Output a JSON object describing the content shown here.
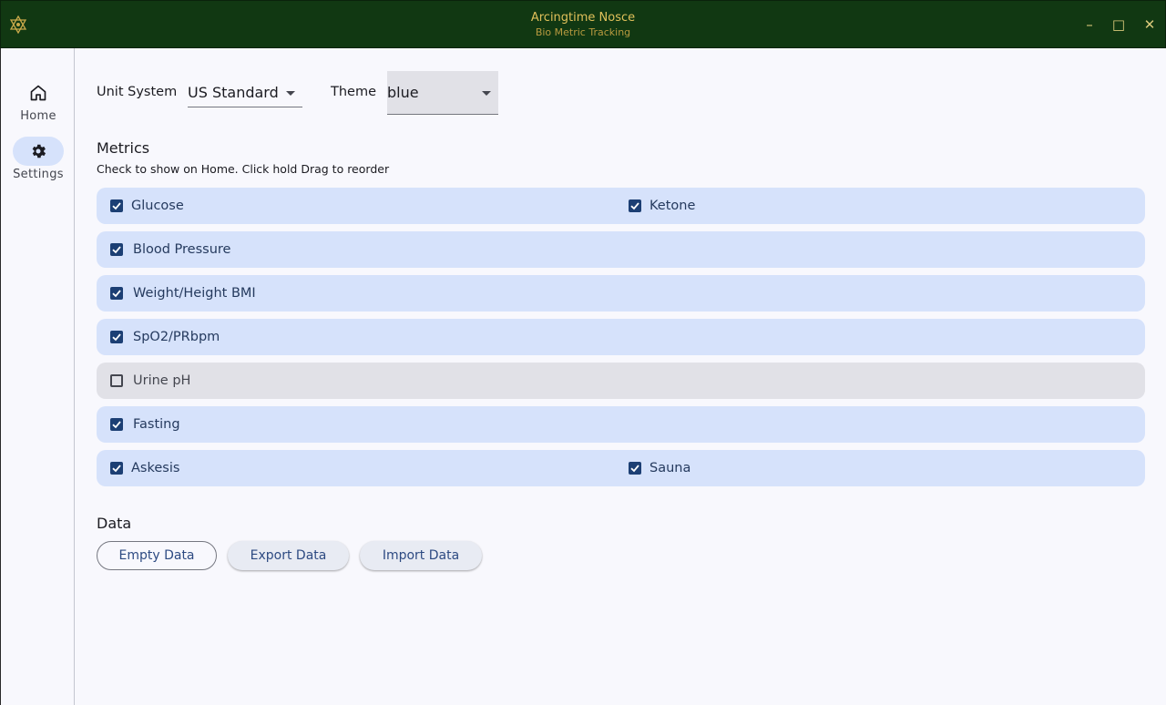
{
  "window": {
    "title": "Arcingtime Nosce",
    "subtitle": "Bio Metric Tracking",
    "minimize_glyph": "–",
    "maximize_glyph": "□",
    "close_glyph": "✕"
  },
  "nav": {
    "items": [
      {
        "label": "Home",
        "icon": "home-icon",
        "active": false
      },
      {
        "label": "Settings",
        "icon": "gear-icon",
        "active": true
      }
    ]
  },
  "settings": {
    "unit_system_label": "Unit System",
    "unit_system_value": "US Standard",
    "theme_label": "Theme",
    "theme_value": "blue"
  },
  "metrics": {
    "title": "Metrics",
    "hint": "Check to show on Home. Click hold Drag to reorder",
    "rows": [
      {
        "items": [
          {
            "label": "Glucose",
            "checked": true
          },
          {
            "label": "Ketone",
            "checked": true
          }
        ]
      },
      {
        "items": [
          {
            "label": "Blood Pressure",
            "checked": true
          }
        ]
      },
      {
        "items": [
          {
            "label": "Weight/Height BMI",
            "checked": true
          }
        ]
      },
      {
        "items": [
          {
            "label": "SpO2/PRbpm",
            "checked": true
          }
        ]
      },
      {
        "items": [
          {
            "label": "Urine pH",
            "checked": false
          }
        ]
      },
      {
        "items": [
          {
            "label": "Fasting",
            "checked": true
          }
        ]
      },
      {
        "items": [
          {
            "label": "Askesis",
            "checked": true
          },
          {
            "label": "Sauna",
            "checked": true
          }
        ]
      }
    ]
  },
  "data_section": {
    "title": "Data",
    "buttons": {
      "empty": "Empty Data",
      "export": "Export Data",
      "import": "Import Data"
    }
  },
  "colors": {
    "titlebar": "#113812",
    "title_text": "#e0c05a",
    "row_enabled": "#d6e2fb",
    "row_disabled": "#e1e1e7",
    "checkbox": "#1c3f74"
  }
}
